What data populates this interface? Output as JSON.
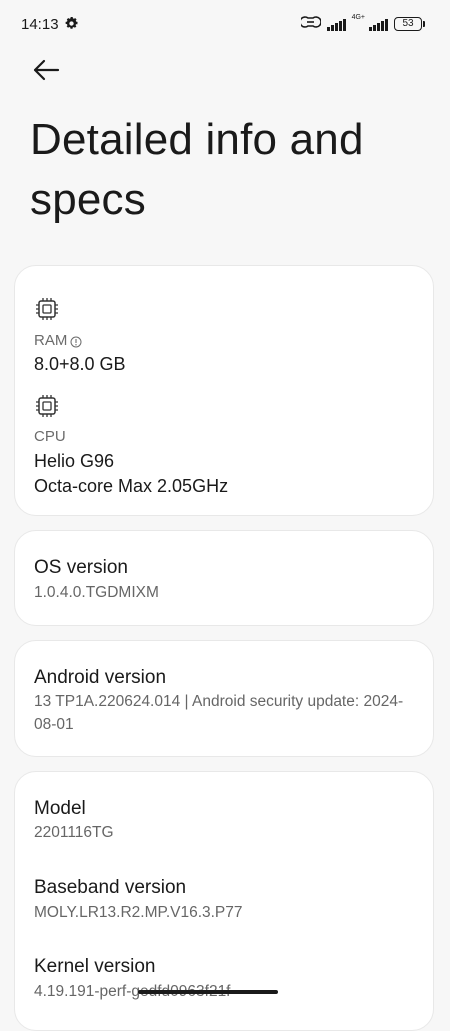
{
  "status_bar": {
    "time": "14:13",
    "network_label": "4G+",
    "battery": "53",
    "icons": [
      "gear-icon",
      "hotspot-icon",
      "signal-icon",
      "signal-icon",
      "battery-icon"
    ]
  },
  "header": {
    "back_icon": "back-arrow-icon",
    "title": "Detailed info and specs"
  },
  "hardware": {
    "ram": {
      "icon": "chip-icon",
      "label": "RAM",
      "info_icon": "info-icon",
      "value": "8.0+8.0 GB"
    },
    "cpu": {
      "icon": "chip-icon",
      "label": "CPU",
      "value_line1": "Helio G96",
      "value_line2": "Octa-core Max 2.05GHz"
    }
  },
  "os": {
    "title": "OS version",
    "value": "1.0.4.0.TGDMIXM"
  },
  "android": {
    "title": "Android version",
    "value": "13 TP1A.220624.014 | Android security update: 2024-08-01"
  },
  "device": {
    "model_title": "Model",
    "model_value": "2201116TG",
    "baseband_title": "Baseband version",
    "baseband_value": "MOLY.LR13.R2.MP.V16.3.P77",
    "kernel_title": "Kernel version",
    "kernel_value": "4.19.191-perf-gedfd0963f21f"
  },
  "colors": {
    "background": "#f7f7f7",
    "card": "#ffffff",
    "primary_text": "#1a1a1a",
    "secondary_text": "#666666"
  }
}
